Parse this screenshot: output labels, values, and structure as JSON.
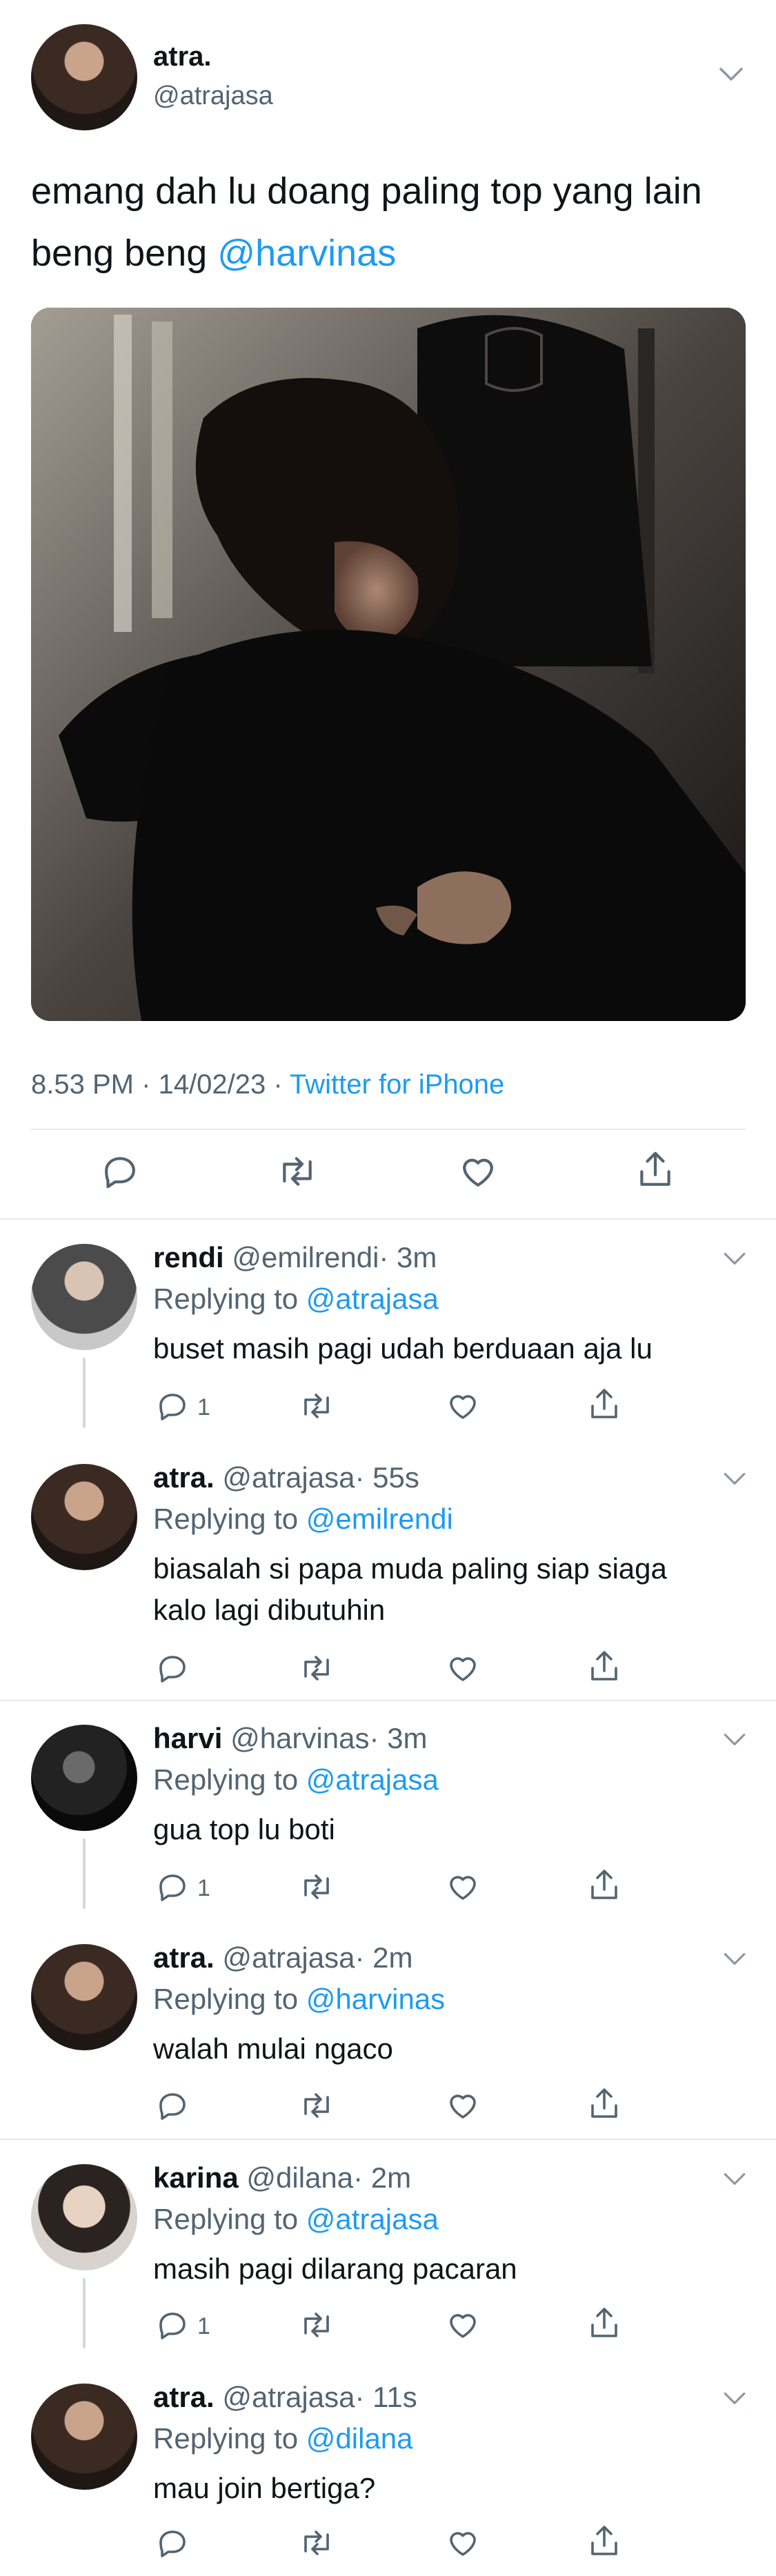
{
  "main_tweet": {
    "author_name": "atra.",
    "author_handle": "@atrajasa",
    "text_part": "emang dah lu doang paling top yang lain beng beng",
    "text_mention": "@harvinas",
    "timestamp": "8.53 PM · 14/02/23 · ",
    "source": "Twitter for iPhone",
    "actions": [
      "reply-icon",
      "retweet-icon",
      "like-icon",
      "share-icon"
    ]
  },
  "replies": [
    {
      "name": "rendi",
      "handle": "@emilrendi",
      "time": "· 3m",
      "replying_label": "Replying to",
      "replying_to": "@atrajasa",
      "text": "buset masih pagi udah berduaan aja lu",
      "reply_count": "1"
    },
    {
      "name": "atra.",
      "handle": "@atrajasa",
      "time": "· 55s",
      "replying_label": "Replying to",
      "replying_to": "@emilrendi",
      "text_line1": "biasalah si papa muda paling siap siaga",
      "text_line2": "kalo lagi dibutuhin"
    },
    {
      "name": "harvi",
      "handle": "@harvinas",
      "time": "· 3m",
      "replying_label": "Replying to",
      "replying_to": "@atrajasa",
      "text": "gua top lu boti",
      "reply_count": "1"
    },
    {
      "name": "atra.",
      "handle": "@atrajasa",
      "time": "· 2m",
      "replying_label": "Replying to",
      "replying_to": "@harvinas",
      "text": "walah mulai ngaco"
    },
    {
      "name": "karina",
      "handle": "@dilana",
      "time": "· 2m",
      "replying_label": "Replying to",
      "replying_to": "@atrajasa",
      "text": "masih pagi dilarang pacaran",
      "reply_count": "1"
    },
    {
      "name": "atra.",
      "handle": "@atrajasa",
      "time": "· 11s",
      "replying_label": "Replying to",
      "replying_to": "@dilana",
      "text": "mau join bertiga?"
    }
  ],
  "colors": {
    "accent": "#1d9bf0",
    "secondary_text": "#536471",
    "divider": "#e6e9ec"
  }
}
